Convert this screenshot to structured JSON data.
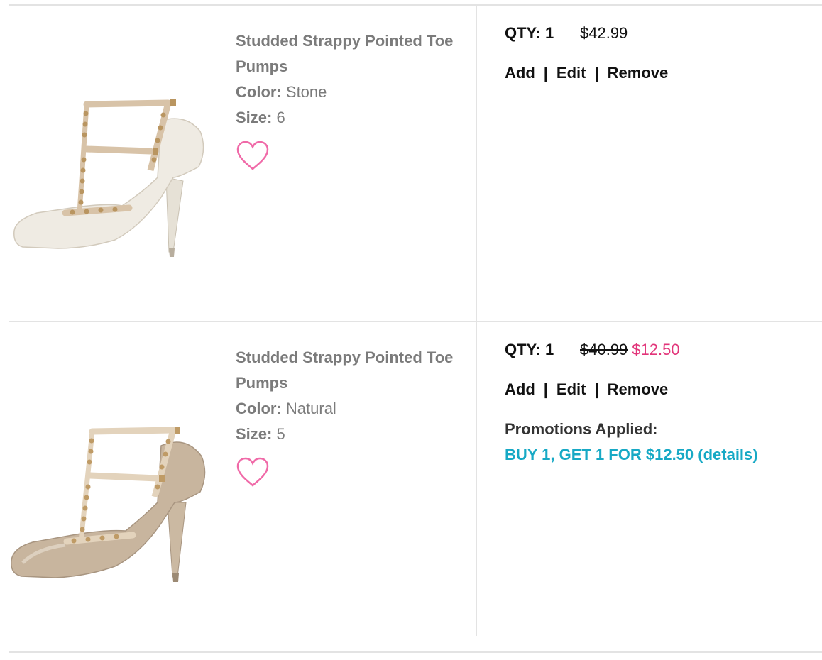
{
  "items": [
    {
      "name": "Studded Strappy Pointed Toe Pumps",
      "color_label": "Color:",
      "color_value": "Stone",
      "size_label": "Size:",
      "size_value": "6",
      "qty_label": "QTY: 1",
      "price": "$42.99",
      "actions": {
        "add": "Add",
        "edit": "Edit",
        "remove": "Remove",
        "sep": "|"
      },
      "shoe_color": "#efebe3",
      "heart_icon": "heart-outline-icon"
    },
    {
      "name": "Studded Strappy Pointed Toe Pumps",
      "color_label": "Color:",
      "color_value": "Natural",
      "size_label": "Size:",
      "size_value": "5",
      "qty_label": "QTY: 1",
      "original_price": "$40.99",
      "sale_price": "$12.50",
      "actions": {
        "add": "Add",
        "edit": "Edit",
        "remove": "Remove",
        "sep": "|"
      },
      "promotions_label": "Promotions Applied:",
      "promotion_text": "BUY 1, GET 1 FOR $12.50 (details)",
      "shoe_color": "#c8b59e",
      "heart_icon": "heart-outline-icon"
    }
  ],
  "colors": {
    "sale": "#e2357a",
    "promo_link": "#17a9c5",
    "heart": "#f06aa8",
    "muted_text": "#7b7b7b"
  }
}
